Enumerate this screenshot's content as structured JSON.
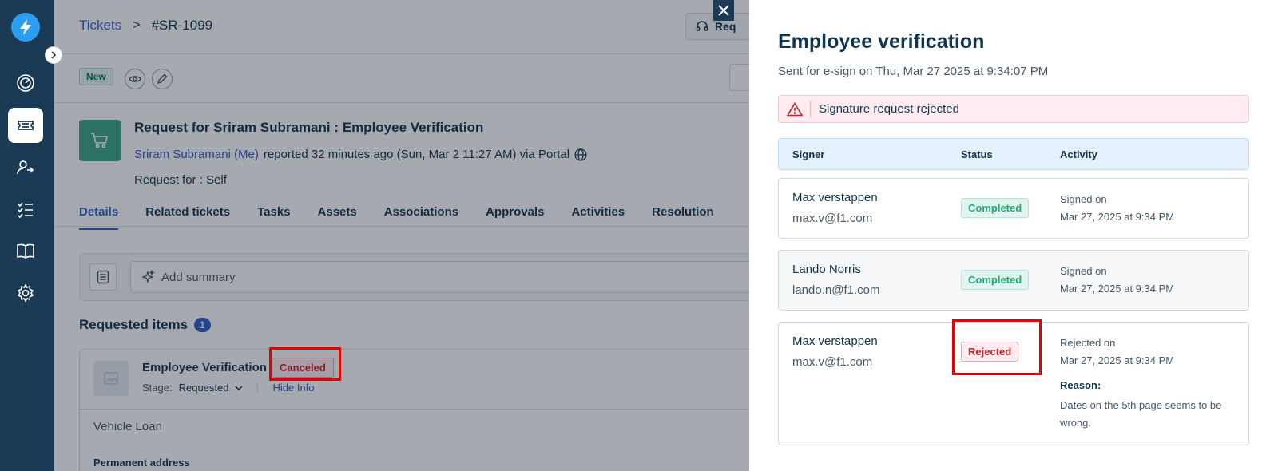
{
  "breadcrumb": {
    "parent": "Tickets",
    "separator": ">",
    "current": "#SR-1099"
  },
  "header_button": {
    "label": "Req"
  },
  "ticket": {
    "status_badge": "New",
    "title": "Request for Sriram Subramani : Employee Verification",
    "reporter": "Sriram Subramani (Me)",
    "reported_text": "reported 32 minutes ago (Sun, Mar 2 11:27 AM) via Portal",
    "request_for_label": "Request for :",
    "request_for_value": "Self"
  },
  "tabs": [
    "Details",
    "Related tickets",
    "Tasks",
    "Assets",
    "Associations",
    "Approvals",
    "Activities",
    "Resolution"
  ],
  "summary": {
    "placeholder": "Add summary"
  },
  "requested_items": {
    "title": "Requested items",
    "count": "1",
    "item": {
      "name": "Employee Verification",
      "status": "Canceled",
      "stage_label": "Stage:",
      "stage_value": "Requested",
      "hide_info": "Hide Info",
      "field_value": "Vehicle Loan",
      "next_field_label": "Permanent address"
    }
  },
  "drawer": {
    "title": "Employee verification",
    "subtitle": "Sent for e-sign on Thu, Mar 27 2025 at 9:34:07 PM",
    "alert": "Signature request rejected",
    "columns": {
      "signer": "Signer",
      "status": "Status",
      "activity": "Activity"
    },
    "rows": [
      {
        "name": "Max verstappen",
        "email": "max.v@f1.com",
        "status": "Completed",
        "activity": "Signed on",
        "date": "Mar 27, 2025 at 9:34 PM"
      },
      {
        "name": "Lando Norris",
        "email": "lando.n@f1.com",
        "status": "Completed",
        "activity": "Signed on",
        "date": "Mar 27, 2025 at 9:34 PM"
      },
      {
        "name": "Max verstappen",
        "email": "max.v@f1.com",
        "status": "Rejected",
        "activity": "Rejected on",
        "date": "Mar 27, 2025 at 9:34 PM",
        "reason_label": "Reason:",
        "reason": "Dates on the 5th page seems to be wrong."
      }
    ]
  },
  "colors": {
    "sidebar": "#1b3a55",
    "link": "#2c5cc5",
    "success": "#24a870",
    "danger": "#c82124",
    "highlight": "#e60000"
  },
  "icons": [
    "lightning-logo-icon",
    "chevron-right-icon",
    "dashboard-icon",
    "ticket-icon",
    "people-swap-icon",
    "checklist-icon",
    "book-icon",
    "gear-icon",
    "headset-icon",
    "eye-icon",
    "pencil-icon",
    "cart-icon",
    "globe-icon",
    "document-icon",
    "sparkle-icon",
    "image-icon",
    "chevron-down-icon",
    "close-icon",
    "warning-icon"
  ]
}
